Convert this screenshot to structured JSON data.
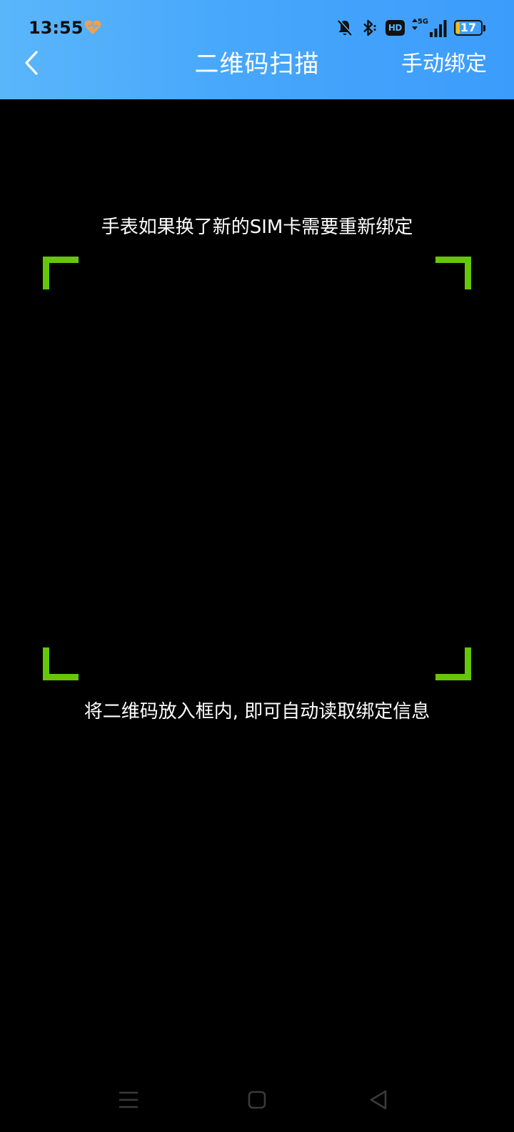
{
  "status_bar": {
    "time": "13:55",
    "network": "5G",
    "hd_label": "HD",
    "battery_level": "17"
  },
  "header": {
    "title": "二维码扫描",
    "manual_bind_label": "手动绑定"
  },
  "scanner": {
    "top_hint": "手表如果换了新的SIM卡需要重新绑定",
    "bottom_hint": "将二维码放入框内, 即可自动读取绑定信息",
    "frame_color": "#66c60a"
  },
  "colors": {
    "header_gradient_start": "#5ab6fb",
    "header_gradient_end": "#3c9cfb",
    "background": "#000000",
    "heart_icon": "#f0a050"
  },
  "icons": {
    "back": "chevron-left-icon",
    "heart": "heart-icon",
    "mute": "bell-off-icon",
    "bluetooth": "bluetooth-icon",
    "signal": "signal-icon",
    "nav_menu": "menu-icon",
    "nav_home": "home-square-icon",
    "nav_back": "back-triangle-icon"
  }
}
